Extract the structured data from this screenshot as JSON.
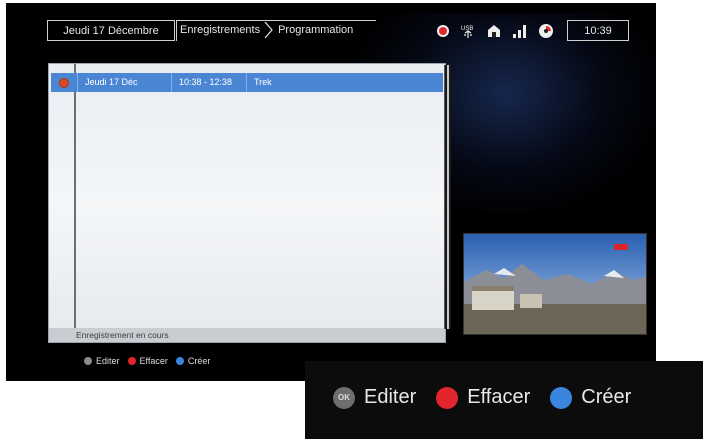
{
  "header": {
    "date": "Jeudi 17 Décembre",
    "breadcrumb": [
      "Enregistrements",
      "Programmation"
    ],
    "clock": "10:39"
  },
  "status_icons": [
    "record-icon",
    "usb-icon",
    "network-icon",
    "signal-icon",
    "wifi-icon"
  ],
  "recordings": {
    "rows": [
      {
        "date": "Jeudi 17 Déc",
        "time": "10:38 - 12:38",
        "title": "Trek"
      }
    ],
    "status": "Enregistrement en cours"
  },
  "legend": {
    "edit": "Editer",
    "delete": "Effacer",
    "create": "Créer",
    "ok_label": "OK"
  },
  "colors": {
    "selected_row": "#4a86d4",
    "red_key": "#e3262e",
    "blue_key": "#3a86df"
  }
}
